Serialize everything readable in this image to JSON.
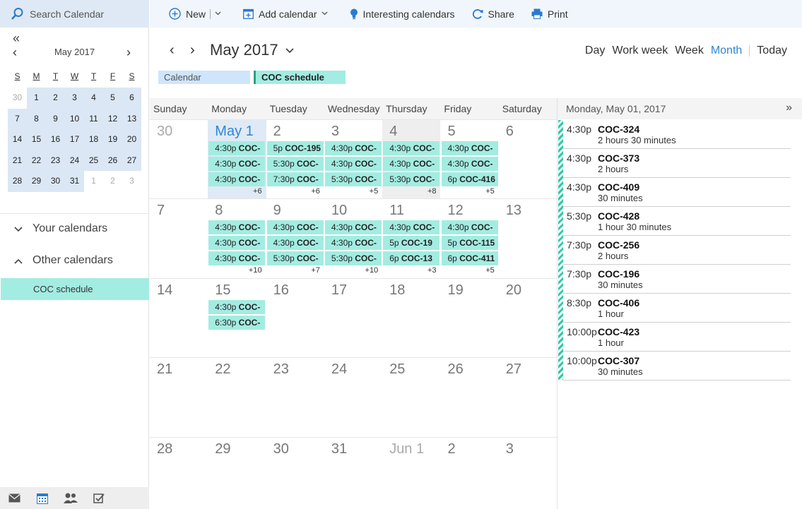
{
  "search": {
    "placeholder": "Search Calendar"
  },
  "mini_calendar": {
    "collapse": "«",
    "title": "May 2017",
    "weekdays": [
      "S",
      "M",
      "T",
      "W",
      "T",
      "F",
      "S"
    ],
    "weeks": [
      [
        "30",
        "1",
        "2",
        "3",
        "4",
        "5",
        "6"
      ],
      [
        "7",
        "8",
        "9",
        "10",
        "11",
        "12",
        "13"
      ],
      [
        "14",
        "15",
        "16",
        "17",
        "18",
        "19",
        "20"
      ],
      [
        "21",
        "22",
        "23",
        "24",
        "25",
        "26",
        "27"
      ],
      [
        "28",
        "29",
        "30",
        "31",
        "1",
        "2",
        "3"
      ]
    ]
  },
  "sidebar": {
    "your_calendars": "Your calendars",
    "other_calendars": "Other calendars",
    "coc_schedule": "COC schedule"
  },
  "toolbar": {
    "new": "New",
    "add_calendar": "Add calendar",
    "interesting": "Interesting calendars",
    "share": "Share",
    "print": "Print"
  },
  "header": {
    "title": "May 2017",
    "views": {
      "day": "Day",
      "work_week": "Work week",
      "week": "Week",
      "month": "Month",
      "today": "Today"
    }
  },
  "calendars": {
    "calendar": "Calendar",
    "coc": "COC schedule"
  },
  "grid": {
    "weekdays": [
      "Sunday",
      "Monday",
      "Tuesday",
      "Wednesday",
      "Thursday",
      "Friday",
      "Saturday"
    ],
    "weeks": [
      [
        {
          "d": "30"
        },
        {
          "d": "May 1",
          "ev": [
            [
              "4:30p",
              "COC-"
            ],
            [
              "4:30p",
              "COC-"
            ],
            [
              "4:30p",
              "COC-"
            ]
          ],
          "more": "+6"
        },
        {
          "d": "2",
          "ev": [
            [
              "5p",
              "COC-195"
            ],
            [
              "5:30p",
              "COC-"
            ],
            [
              "7:30p",
              "COC-"
            ]
          ],
          "more": "+6"
        },
        {
          "d": "3",
          "ev": [
            [
              "4:30p",
              "COC-"
            ],
            [
              "4:30p",
              "COC-"
            ],
            [
              "5:30p",
              "COC-"
            ]
          ],
          "more": "+5"
        },
        {
          "d": "4",
          "ev": [
            [
              "4:30p",
              "COC-"
            ],
            [
              "4:30p",
              "COC-"
            ],
            [
              "5:30p",
              "COC-"
            ]
          ],
          "more": "+8"
        },
        {
          "d": "5",
          "ev": [
            [
              "4:30p",
              "COC-"
            ],
            [
              "4:30p",
              "COC-"
            ],
            [
              "6p",
              "COC-416"
            ]
          ],
          "more": "+5"
        },
        {
          "d": "6"
        }
      ],
      [
        {
          "d": "7"
        },
        {
          "d": "8",
          "ev": [
            [
              "4:30p",
              "COC-"
            ],
            [
              "4:30p",
              "COC-"
            ],
            [
              "4:30p",
              "COC-"
            ]
          ],
          "more": "+10"
        },
        {
          "d": "9",
          "ev": [
            [
              "4:30p",
              "COC-"
            ],
            [
              "4:30p",
              "COC-"
            ],
            [
              "5:30p",
              "COC-"
            ]
          ],
          "more": "+7"
        },
        {
          "d": "10",
          "ev": [
            [
              "4:30p",
              "COC-"
            ],
            [
              "4:30p",
              "COC-"
            ],
            [
              "5:30p",
              "COC-"
            ]
          ],
          "more": "+10"
        },
        {
          "d": "11",
          "ev": [
            [
              "4:30p",
              "COC-"
            ],
            [
              "5p",
              "COC-19"
            ],
            [
              "6p",
              "COC-13"
            ]
          ],
          "more": "+3"
        },
        {
          "d": "12",
          "ev": [
            [
              "4:30p",
              "COC-"
            ],
            [
              "5p",
              "COC-115"
            ],
            [
              "6p",
              "COC-411"
            ]
          ],
          "more": "+5"
        },
        {
          "d": "13"
        }
      ],
      [
        {
          "d": "14"
        },
        {
          "d": "15",
          "ev": [
            [
              "4:30p",
              "COC-"
            ],
            [
              "6:30p",
              "COC-"
            ]
          ]
        },
        {
          "d": "16"
        },
        {
          "d": "17"
        },
        {
          "d": "18"
        },
        {
          "d": "19"
        },
        {
          "d": "20"
        }
      ],
      [
        {
          "d": "21"
        },
        {
          "d": "22"
        },
        {
          "d": "23"
        },
        {
          "d": "24"
        },
        {
          "d": "25"
        },
        {
          "d": "26"
        },
        {
          "d": "27"
        }
      ],
      [
        {
          "d": "28"
        },
        {
          "d": "29"
        },
        {
          "d": "30"
        },
        {
          "d": "31"
        },
        {
          "d": "Jun 1"
        },
        {
          "d": "2"
        },
        {
          "d": "3"
        }
      ]
    ]
  },
  "agenda": {
    "title": "Monday, May 01, 2017",
    "expand": "»",
    "items": [
      {
        "time": "4:30p",
        "subject": "COC-324",
        "duration": "2 hours 30 minutes"
      },
      {
        "time": "4:30p",
        "subject": "COC-373",
        "duration": "2 hours"
      },
      {
        "time": "4:30p",
        "subject": "COC-409",
        "duration": "30 minutes"
      },
      {
        "time": "5:30p",
        "subject": "COC-428",
        "duration": "1 hour 30 minutes"
      },
      {
        "time": "7:30p",
        "subject": "COC-256",
        "duration": "2 hours"
      },
      {
        "time": "7:30p",
        "subject": "COC-196",
        "duration": "30 minutes"
      },
      {
        "time": "8:30p",
        "subject": "COC-406",
        "duration": "1 hour"
      },
      {
        "time": "10:00p",
        "subject": "COC-423",
        "duration": "1 hour"
      },
      {
        "time": "10:00p",
        "subject": "COC-307",
        "duration": "30 minutes"
      }
    ]
  }
}
